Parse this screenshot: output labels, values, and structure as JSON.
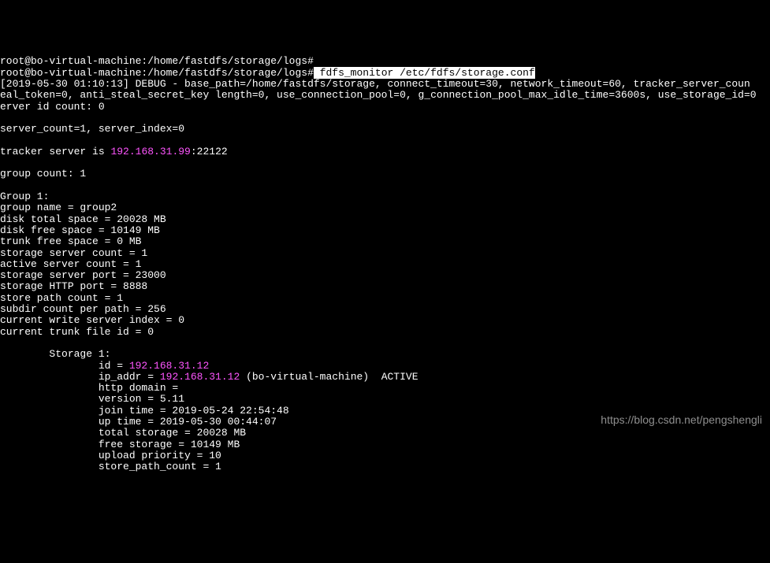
{
  "prompt_line_prev": "root@bo-virtual-machine:/home/fastdfs/storage/logs#",
  "prompt_line": "root@bo-virtual-machine:/home/fastdfs/storage/logs#",
  "command": " fdfs_monitor /etc/fdfs/storage.conf",
  "debug_line1": "[2019-05-30 01:10:13] DEBUG - base_path=/home/fastdfs/storage, connect_timeout=30, network_timeout=60, tracker_server_coun",
  "debug_line2": "eal_token=0, anti_steal_secret_key length=0, use_connection_pool=0, g_connection_pool_max_idle_time=3600s, use_storage_id=0",
  "server_id_count": "erver id count: 0",
  "server_count": "server_count=1, server_index=0",
  "tracker_prefix": "tracker server is ",
  "tracker_ip": "192.168.31.99",
  "tracker_port": ":22122",
  "group_count": "group count: 1",
  "group_header": "Group 1:",
  "group_name": "group name = group2",
  "disk_total": "disk total space = 20028 MB",
  "disk_free": "disk free space = 10149 MB",
  "trunk_free": "trunk free space = 0 MB",
  "storage_count": "storage server count = 1",
  "active_count": "active server count = 1",
  "storage_port": "storage server port = 23000",
  "http_port": "storage HTTP port = 8888",
  "store_path_count": "store path count = 1",
  "subdir_count": "subdir count per path = 256",
  "write_index": "current write server index = 0",
  "trunk_file_id": "current trunk file id = 0",
  "storage_header": "        Storage 1:",
  "storage_id_prefix": "                id = ",
  "storage_id_ip": "192.168.31.12",
  "storage_ip_prefix": "                ip_addr = ",
  "storage_ip_addr": "192.168.31.12",
  "storage_ip_suffix": " (bo-virtual-machine)  ACTIVE",
  "http_domain": "                http domain =",
  "version": "                version = 5.11",
  "join_time": "                join time = 2019-05-24 22:54:48",
  "up_time": "                up time = 2019-05-30 00:44:07",
  "total_storage": "                total storage = 20028 MB",
  "free_storage": "                free storage = 10149 MB",
  "upload_priority": "                upload priority = 10",
  "store_path_count_2": "                store_path_count = 1",
  "watermark": "https://blog.csdn.net/pengshengli"
}
